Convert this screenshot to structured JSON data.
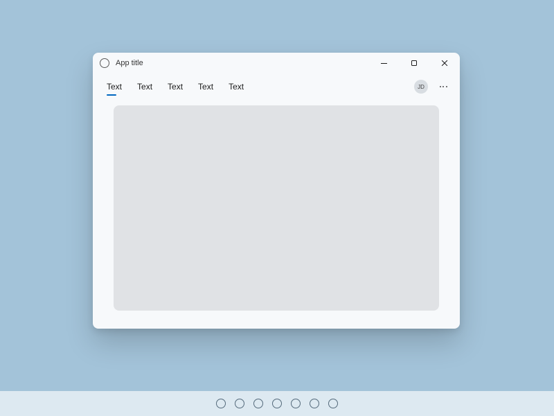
{
  "window": {
    "title": "App title"
  },
  "tabs": [
    {
      "label": "Text",
      "selected": true
    },
    {
      "label": "Text",
      "selected": false
    },
    {
      "label": "Text",
      "selected": false
    },
    {
      "label": "Text",
      "selected": false
    },
    {
      "label": "Text",
      "selected": false
    }
  ],
  "user": {
    "initials": "JD"
  },
  "taskbar": {
    "item_count": 7
  }
}
